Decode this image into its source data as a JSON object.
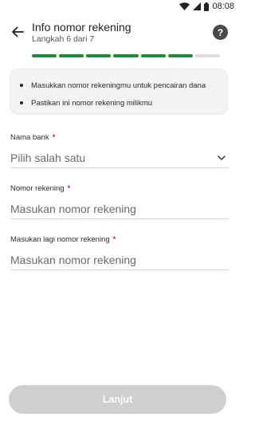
{
  "status_bar": {
    "time": "08:08"
  },
  "header": {
    "title": "Info nomor rekening",
    "subtitle": "Langkah 6 dari 7",
    "help_glyph": "?"
  },
  "progress": {
    "current_step": 6,
    "total_steps": 7,
    "color": "#1e8a3c"
  },
  "info": {
    "items": [
      "Masukkan nomor rekeningmu untuk pencairan dana",
      "Pastikan ini nomor rekening milikmu"
    ]
  },
  "form": {
    "bank": {
      "label": "Nama bank",
      "required_mark": "*",
      "placeholder": "Pilih salah satu"
    },
    "account": {
      "label": "Nomor rekening",
      "required_mark": "*",
      "placeholder": "Masukan nomor rekening"
    },
    "account_confirm": {
      "label": "Masukan lagi nomor rekening",
      "required_mark": "*",
      "placeholder": "Masukan nomor rekening"
    }
  },
  "footer": {
    "next_label": "Lanjut"
  },
  "icons": {
    "back": "arrow-left-icon",
    "help": "help-icon",
    "dropdown": "chevron-down-icon",
    "wifi": "wifi-icon",
    "signal": "signal-icon",
    "battery": "battery-icon"
  }
}
